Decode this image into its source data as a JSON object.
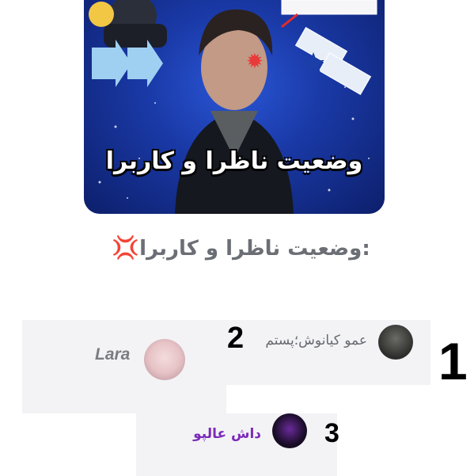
{
  "cover": {
    "text": "وضعیت ناظرا و کاربرا"
  },
  "section": {
    "title": ":وضعیت ناظرا و کاربرا",
    "emoji": "anger-symbol-icon"
  },
  "users": [
    {
      "rank": "1",
      "name": "عمو کیانوش؛پستم"
    },
    {
      "rank": "2",
      "name": "Lara"
    },
    {
      "rank": "3",
      "name": "داش عالپو"
    }
  ],
  "colors": {
    "name_purple": "#7b2bb7",
    "name_gray": "#666a70",
    "card_bg": "#f3f3f6"
  }
}
